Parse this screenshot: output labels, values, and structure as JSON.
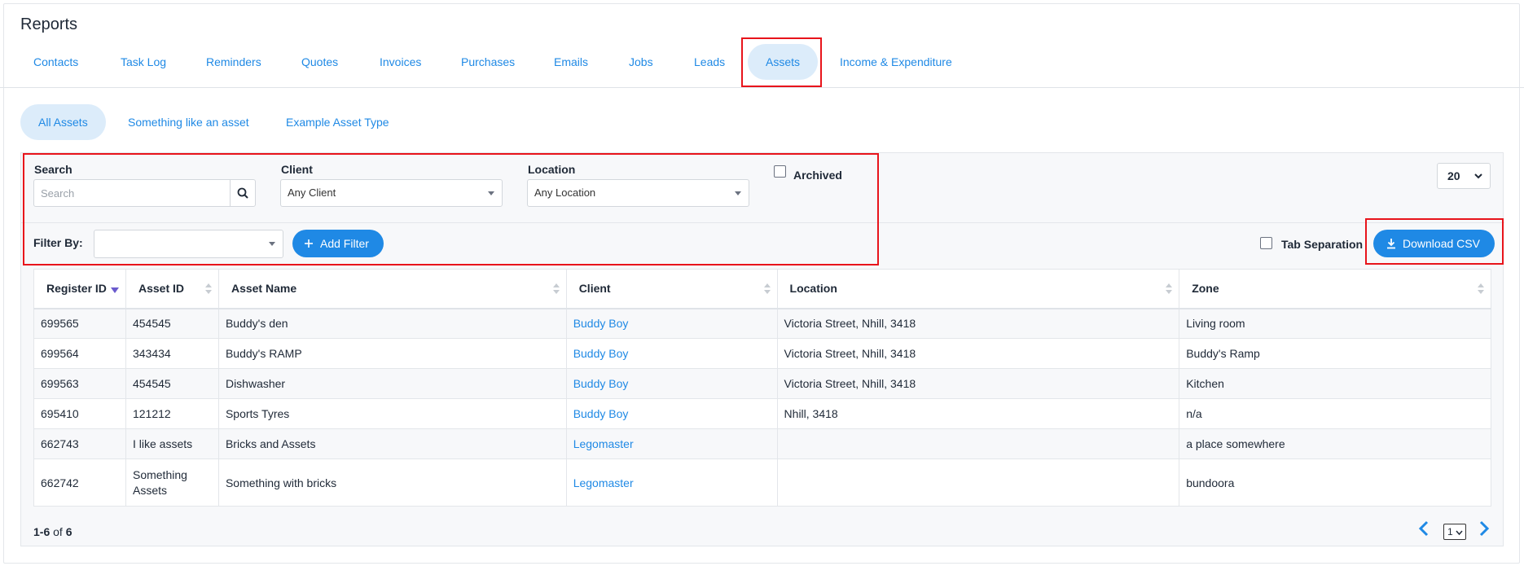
{
  "page": {
    "title": "Reports"
  },
  "report_tabs": [
    {
      "label": "Contacts"
    },
    {
      "label": "Task Log"
    },
    {
      "label": "Reminders"
    },
    {
      "label": "Quotes"
    },
    {
      "label": "Invoices"
    },
    {
      "label": "Purchases"
    },
    {
      "label": "Emails"
    },
    {
      "label": "Jobs"
    },
    {
      "label": "Leads"
    },
    {
      "label": "Assets",
      "active": true
    },
    {
      "label": "Income & Expenditure"
    }
  ],
  "asset_tabs": [
    {
      "label": "All Assets",
      "active": true
    },
    {
      "label": "Something like an asset"
    },
    {
      "label": "Example Asset Type"
    }
  ],
  "filters": {
    "search_label": "Search",
    "search_placeholder": "Search",
    "search_value": "",
    "client_label": "Client",
    "client_value": "Any Client",
    "location_label": "Location",
    "location_value": "Any Location",
    "archived_label": "Archived",
    "archived_checked": false,
    "filter_by_label": "Filter By:",
    "filter_by_value": "",
    "add_filter_label": "Add Filter"
  },
  "per_page": "20",
  "export": {
    "tab_separation_label": "Tab Separation",
    "tab_separation_checked": false,
    "download_label": "Download CSV"
  },
  "table": {
    "columns": [
      "Register ID",
      "Asset ID",
      "Asset Name",
      "Client",
      "Location",
      "Zone"
    ],
    "sorted_column": "Register ID",
    "rows": [
      {
        "register_id": "699565",
        "asset_id": "454545",
        "asset_name": "Buddy's den",
        "client": "Buddy Boy",
        "location": "Victoria Street, Nhill, 3418",
        "zone": "Living room"
      },
      {
        "register_id": "699564",
        "asset_id": "343434",
        "asset_name": "Buddy's RAMP",
        "client": "Buddy Boy",
        "location": "Victoria Street, Nhill, 3418",
        "zone": "Buddy's Ramp"
      },
      {
        "register_id": "699563",
        "asset_id": "454545",
        "asset_name": "Dishwasher",
        "client": "Buddy Boy",
        "location": "Victoria Street, Nhill, 3418",
        "zone": "Kitchen"
      },
      {
        "register_id": "695410",
        "asset_id": "121212",
        "asset_name": "Sports Tyres",
        "client": "Buddy Boy",
        "location": "Nhill, 3418",
        "zone": "n/a"
      },
      {
        "register_id": "662743",
        "asset_id": "I like assets",
        "asset_name": "Bricks and Assets",
        "client": "Legomaster",
        "location": "",
        "zone": "a place somewhere"
      },
      {
        "register_id": "662742",
        "asset_id": "Something Assets",
        "asset_name": "Something with bricks",
        "client": "Legomaster",
        "location": "",
        "zone": "bundoora"
      }
    ]
  },
  "pagination": {
    "range": "1-6",
    "of_word": "of",
    "total": "6",
    "current_page": "1"
  },
  "colors": {
    "accent": "#1f89e5",
    "active_tab_bg": "#dcecfa",
    "highlight": "#e8141b"
  },
  "icons": {
    "search": "search-icon",
    "plus": "plus-icon",
    "download": "download-icon",
    "prev": "chevron-left-icon",
    "next": "chevron-right-icon"
  }
}
